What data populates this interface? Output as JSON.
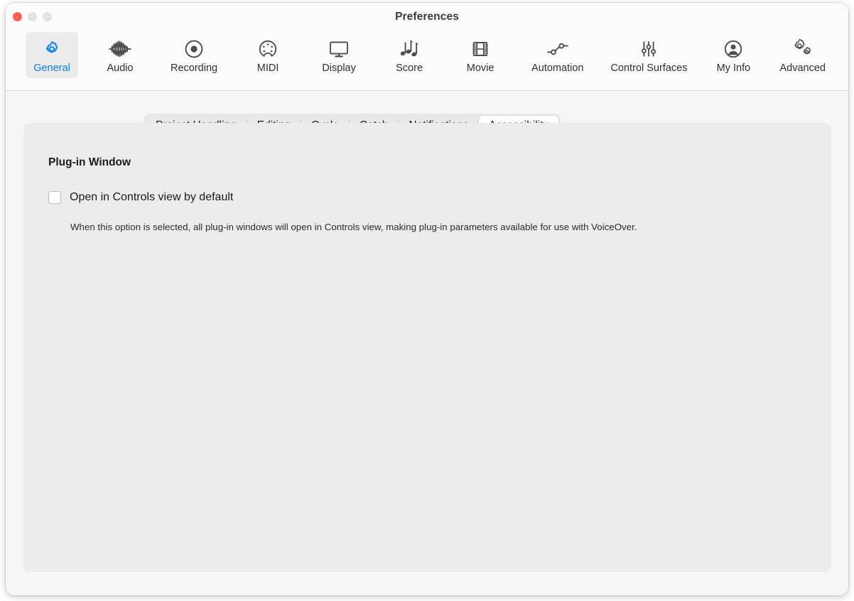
{
  "window": {
    "title": "Preferences",
    "traffic_lights": [
      "close",
      "minimize",
      "zoom"
    ]
  },
  "toolbar": {
    "items": [
      {
        "label": "General",
        "icon": "gear-icon",
        "selected": true
      },
      {
        "label": "Audio",
        "icon": "waveform-icon",
        "selected": false
      },
      {
        "label": "Recording",
        "icon": "record-circle-icon",
        "selected": false
      },
      {
        "label": "MIDI",
        "icon": "midi-din-icon",
        "selected": false
      },
      {
        "label": "Display",
        "icon": "monitor-icon",
        "selected": false
      },
      {
        "label": "Score",
        "icon": "music-notes-icon",
        "selected": false
      },
      {
        "label": "Movie",
        "icon": "film-strip-icon",
        "selected": false
      },
      {
        "label": "Automation",
        "icon": "automation-nodes-icon",
        "selected": false
      },
      {
        "label": "Control Surfaces",
        "icon": "faders-icon",
        "selected": false
      },
      {
        "label": "My Info",
        "icon": "person-circle-icon",
        "selected": false
      },
      {
        "label": "Advanced",
        "icon": "double-gear-icon",
        "selected": false
      }
    ]
  },
  "tabs": {
    "items": [
      {
        "label": "Project Handling",
        "selected": false
      },
      {
        "label": "Editing",
        "selected": false
      },
      {
        "label": "Cycle",
        "selected": false
      },
      {
        "label": "Catch",
        "selected": false
      },
      {
        "label": "Notifications",
        "selected": false
      },
      {
        "label": "Accessibility",
        "selected": true
      }
    ]
  },
  "content": {
    "section_title": "Plug-in Window",
    "checkbox": {
      "label": "Open in Controls view by default",
      "checked": false
    },
    "help_text": "When this option is selected, all plug-in windows will open in Controls view, making plug-in parameters available for use with VoiceOver."
  },
  "colors": {
    "accent": "#0a7cff",
    "close_button": "#ff5f57",
    "inactive_button": "#e2e2e2",
    "panel_bg": "#ececec",
    "window_bg": "#f6f6f6",
    "toolbar_bg": "#fbfbfb"
  }
}
